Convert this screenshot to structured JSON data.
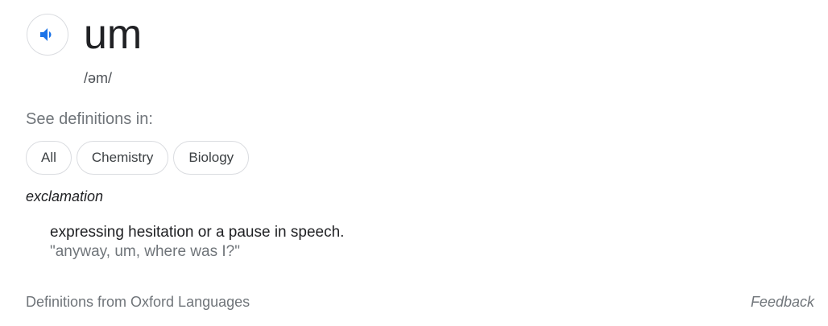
{
  "entry": {
    "word": "um",
    "phonetic": "/əm/",
    "audio_icon": "speaker-icon"
  },
  "see_definitions": {
    "label": "See definitions in:",
    "chips": [
      {
        "label": "All"
      },
      {
        "label": "Chemistry"
      },
      {
        "label": "Biology"
      }
    ]
  },
  "sense": {
    "part_of_speech": "exclamation",
    "definition": "expressing hesitation or a pause in speech.",
    "example": "\"anyway, um, where was I?\""
  },
  "footer": {
    "source": "Definitions from Oxford Languages",
    "feedback": "Feedback"
  },
  "colors": {
    "accent": "#1a73e8",
    "text": "#202124",
    "muted": "#70757a",
    "border": "#dadce0"
  }
}
